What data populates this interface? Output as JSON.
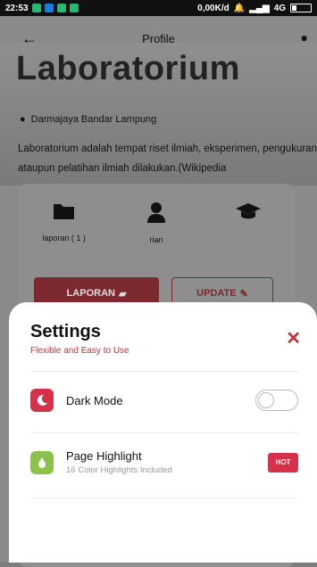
{
  "status_bar": {
    "time": "22:53",
    "network_speed": "0,00K/d",
    "signal_text": "4G",
    "notification_colors": [
      "#2bb673",
      "#1f7be0",
      "#2bb673",
      "#2bb673"
    ]
  },
  "appbar": {
    "title": "Profile",
    "back_icon": "arrow-left-icon",
    "right_icon": "lightbulb-icon"
  },
  "hero": {
    "title": "Laboratorium",
    "location": "Darmajaya Bandar Lampung",
    "description": "Laboratorium adalah tempat riset ilmiah, eksperimen, pengukuran ataupun pelatihan ilmiah dilakukan.(Wikipedia"
  },
  "stats": [
    {
      "icon": "folder-icon",
      "value": "laporan ( 1 )"
    },
    {
      "icon": "user-icon",
      "value": "rian"
    },
    {
      "icon": "graduation-cap-icon",
      "value": ""
    }
  ],
  "actions": {
    "laporan_label": "LAPORAN",
    "update_label": "UPDATE"
  },
  "settings": {
    "title": "Settings",
    "subtitle": "Flexible and Easy to Use",
    "items": [
      {
        "label": "Dark Mode",
        "icon": "moon-icon",
        "icon_color": "#d6314b",
        "toggle_on": false
      },
      {
        "label": "Page Highlight",
        "sub": "16 Color Highlights Included",
        "icon": "drop-icon",
        "icon_color": "#8bc34a",
        "badge": "HOT"
      }
    ]
  },
  "colors": {
    "accent": "#c0313d",
    "hot_badge": "#d6314b"
  }
}
